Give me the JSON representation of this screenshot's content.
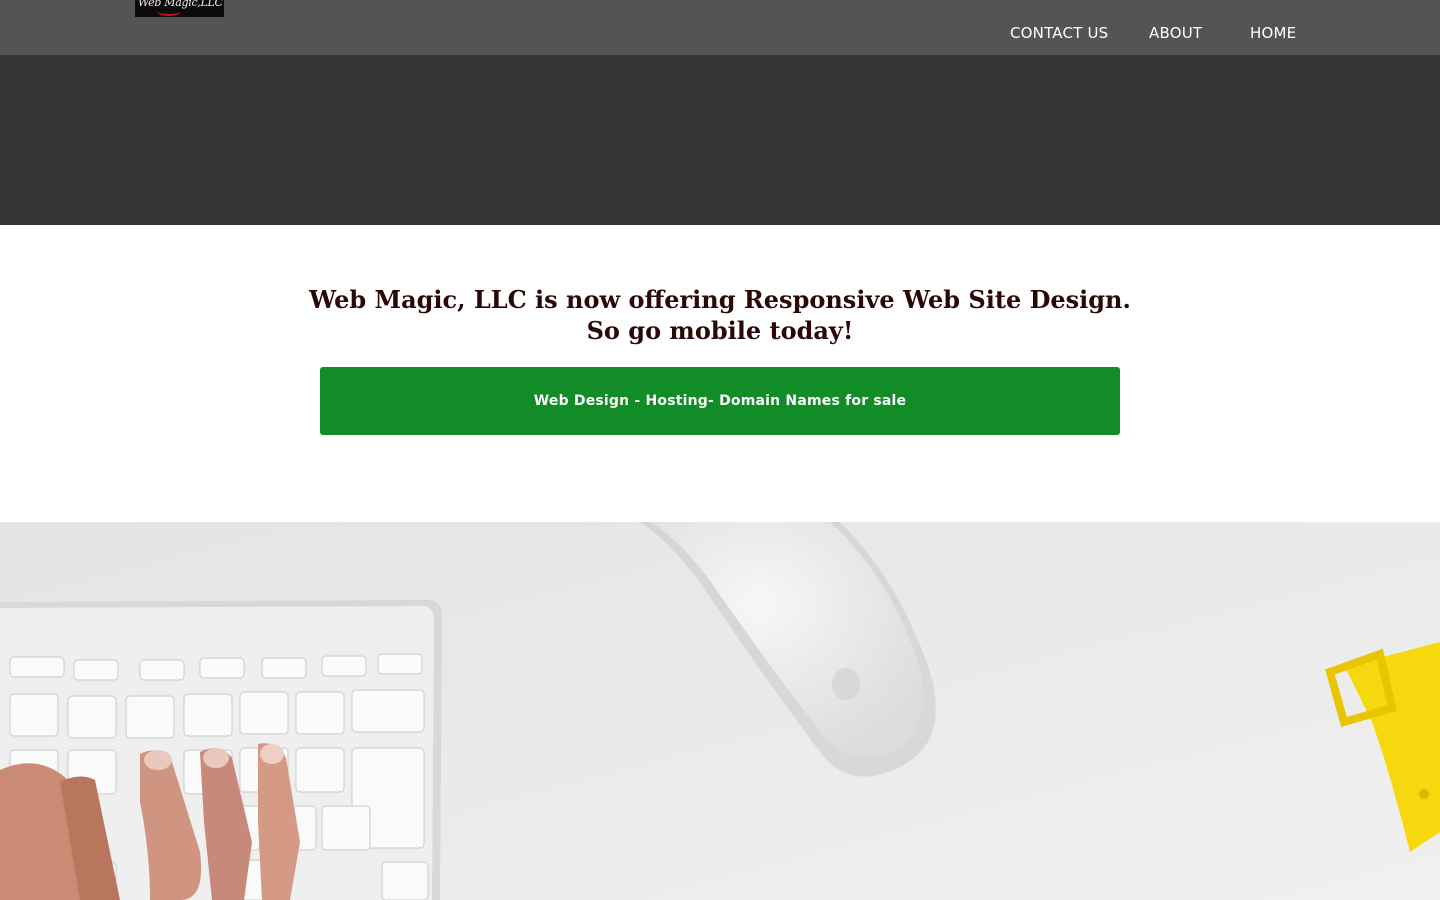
{
  "header": {
    "logo_text": "Web Magic,LLC",
    "nav": {
      "contact": "CONTACT US",
      "about": "ABOUT",
      "home": "HOME"
    }
  },
  "main": {
    "headline": "Web Magic, LLC is now offering Responsive Web Site Design. So go mobile today!",
    "cta_label": "Web Design - Hosting- Domain Names for sale"
  },
  "colors": {
    "navbar": "#545454",
    "banner": "#363636",
    "cta": "#118c27",
    "headline": "#2a0808"
  },
  "hero": {
    "icons": [
      "keyboard-icon",
      "hand-icon",
      "mouse-icon",
      "watch-strap-icon"
    ]
  }
}
